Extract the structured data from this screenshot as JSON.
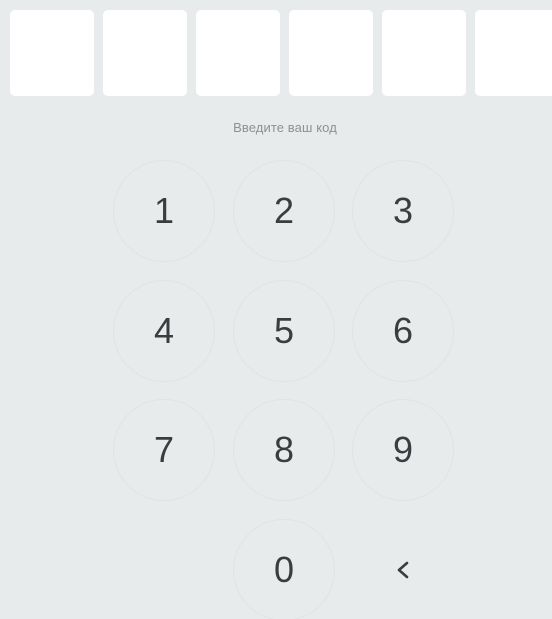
{
  "code_input": {
    "slots": [
      "",
      "",
      "",
      "",
      "",
      ""
    ]
  },
  "prompt": "Введите ваш код",
  "keypad": {
    "keys": [
      "1",
      "2",
      "3",
      "4",
      "5",
      "6",
      "7",
      "8",
      "9",
      "0"
    ],
    "backspace_symbol": "<",
    "backspace_icon": "backspace-chevron-icon"
  },
  "colors": {
    "background": "#e8ebec",
    "slot_fill": "#ffffff",
    "digit_text": "#3a3d3f",
    "prompt_text": "#8c9193",
    "key_outline": "#dfe3e4"
  }
}
